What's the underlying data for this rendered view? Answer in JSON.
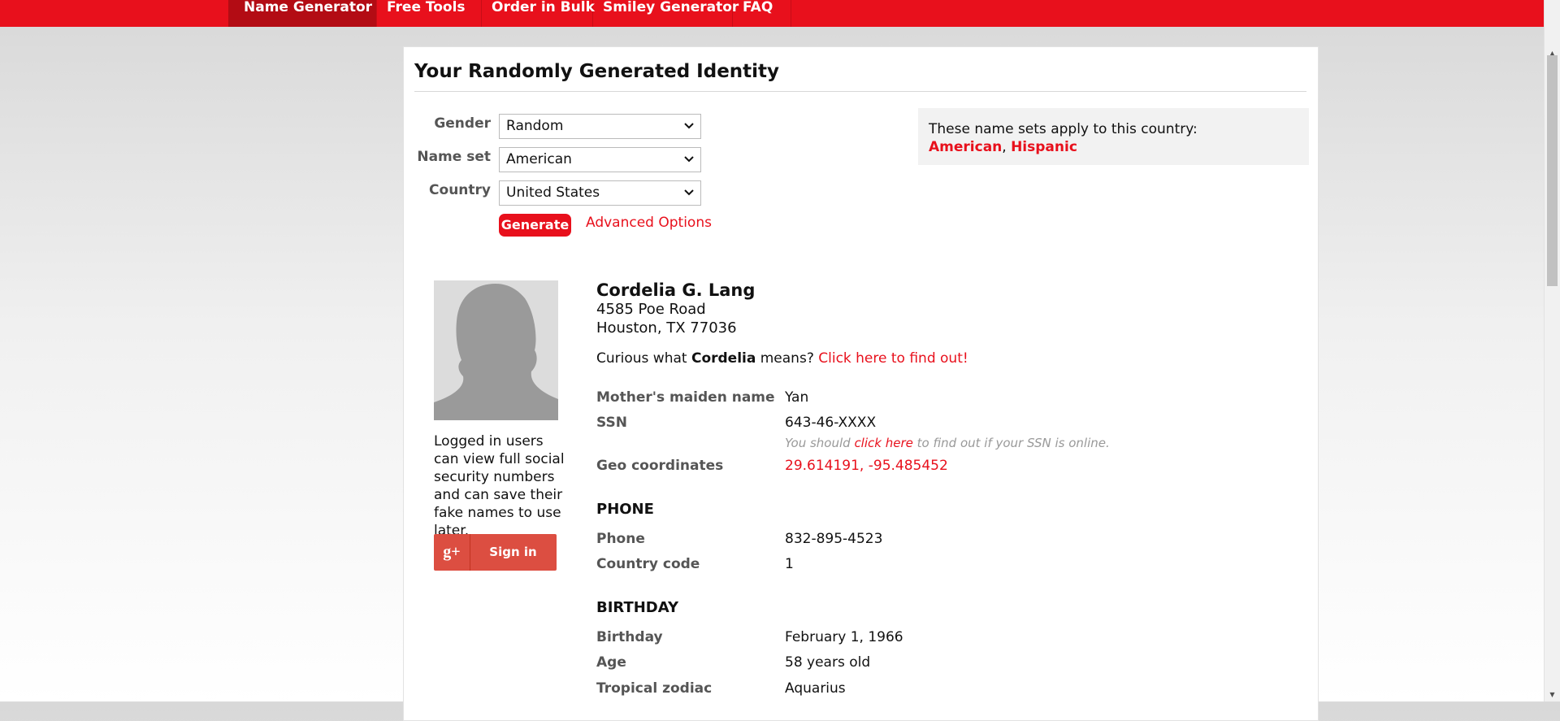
{
  "nav": {
    "items": [
      "Name Generator",
      "Free Tools",
      "Order in Bulk",
      "Smiley Generator",
      "FAQ"
    ]
  },
  "colors": {
    "brand_red": "#e8101c",
    "nav_active": "#b30c14"
  },
  "panel": {
    "title": "Your Randomly Generated Identity"
  },
  "form": {
    "gender_label": "Gender",
    "gender_value": "Random",
    "nameset_label": "Name set",
    "nameset_value": "American",
    "country_label": "Country",
    "country_value": "United States",
    "generate_label": "Generate",
    "advanced_label": "Advanced Options"
  },
  "country_box": {
    "text": "These name sets apply to this country:",
    "link1": "American",
    "sep": ", ",
    "link2": "Hispanic"
  },
  "sidebar": {
    "login_text": "Logged in users can view full social security numbers and can save their fake names to use later.",
    "gplus_icon": "g+",
    "signin_label": "Sign in"
  },
  "identity": {
    "name": "Cordelia G. Lang",
    "address1": "4585 Poe Road",
    "address2": "Houston, TX 77036",
    "curious_prefix": "Curious what ",
    "first_name": "Cordelia",
    "curious_suffix": " means? ",
    "curious_link": "Click here to find out!",
    "maiden_label": "Mother's maiden name",
    "maiden_value": "Yan",
    "ssn_label": "SSN",
    "ssn_value": "643-46-XXXX",
    "ssn_note_prefix": "You should ",
    "ssn_note_link": "click here",
    "ssn_note_suffix": " to find out if your SSN is online.",
    "geo_label": "Geo coordinates",
    "geo_value": "29.614191, -95.485452"
  },
  "phone_section": {
    "heading": "PHONE",
    "phone_label": "Phone",
    "phone_value": "832-895-4523",
    "code_label": "Country code",
    "code_value": "1"
  },
  "birthday_section": {
    "heading": "BIRTHDAY",
    "birthday_label": "Birthday",
    "birthday_value": "February 1, 1966",
    "age_label": "Age",
    "age_value": "58 years old",
    "zodiac_label": "Tropical zodiac",
    "zodiac_value": "Aquarius"
  }
}
